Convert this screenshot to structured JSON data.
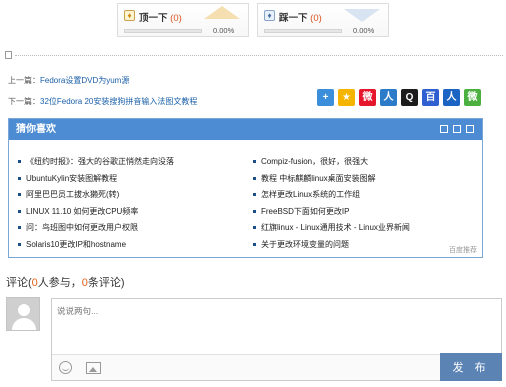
{
  "votes": {
    "up": {
      "label": "顶一下",
      "count": "(0)",
      "percent_text": "0.00%",
      "percent": 0
    },
    "down": {
      "label": "踩一下",
      "count": "(0)",
      "percent_text": "0.00%",
      "percent": 0
    }
  },
  "nav": {
    "prev_prefix": "上一篇：",
    "prev_title": "Fedora设置DVD为yum源",
    "next_prefix": "下一篇：",
    "next_title": "32位Fedora 20安装搜狗拼音输入法图文教程"
  },
  "share": [
    {
      "icon": "plus-share-icon",
      "glyph": "+",
      "color": "#3b8ed9"
    },
    {
      "icon": "star-share-icon",
      "glyph": "★",
      "color": "#f5b400"
    },
    {
      "icon": "weibo-share-icon",
      "glyph": "微",
      "color": "#e6162d"
    },
    {
      "icon": "renren-share-icon",
      "glyph": "人",
      "color": "#2b7bc8"
    },
    {
      "icon": "qq-share-icon",
      "glyph": "Q",
      "color": "#1c1c1c"
    },
    {
      "icon": "baidu-share-icon",
      "glyph": "百",
      "color": "#2f5fd0"
    },
    {
      "icon": "people-share-icon",
      "glyph": "人",
      "color": "#1b64c3"
    },
    {
      "icon": "wechat-share-icon",
      "glyph": "微",
      "color": "#4cb040"
    }
  ],
  "recommend": {
    "title": "猜你喜欢",
    "left": [
      "《纽约时报》：强大的谷歌正悄然走向没落",
      "UbuntuKylin安装图解教程",
      "阿里巴巴员工拔水獭死(转)",
      "LINUX 11.10 如何更改CPU频率",
      "问：鸟班图中如何更改用户权限",
      "Solaris10更改IP和hostname"
    ],
    "right": [
      "Compiz-fusion，很好，很强大",
      "教程 中标麒麟linux桌面安装图解",
      "怎样更改Linux系统的工作组",
      "FreeBSD下面如何更改IP",
      "红旗linux - Linux通用技术 - Linux业界新闻",
      "关于更改环境变量的问题"
    ],
    "footer": "百度推荐"
  },
  "comments": {
    "title_prefix": "评论(",
    "people_count": "0",
    "people_label": "人参与，",
    "comment_count": "0",
    "comment_label": "条评论)",
    "placeholder": "说说两句...",
    "submit_label": "发 布"
  }
}
